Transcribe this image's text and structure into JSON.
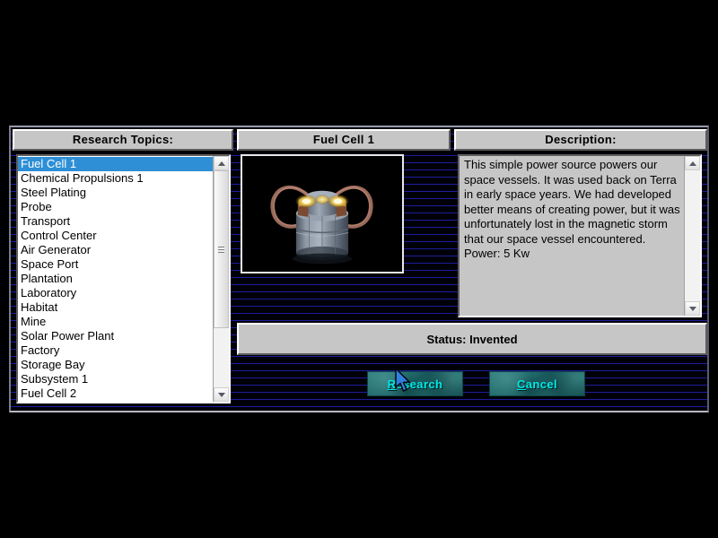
{
  "dialog": {
    "panels": {
      "research_topics_header": "Research Topics:",
      "selected_topic_header": "Fuel Cell 1",
      "description_header": "Description:"
    },
    "topics": [
      {
        "label": "Fuel Cell 1",
        "selected": true
      },
      {
        "label": "Chemical Propulsions 1",
        "selected": false
      },
      {
        "label": "Steel Plating",
        "selected": false
      },
      {
        "label": "Probe",
        "selected": false
      },
      {
        "label": "Transport",
        "selected": false
      },
      {
        "label": "Control Center",
        "selected": false
      },
      {
        "label": "Air Generator",
        "selected": false
      },
      {
        "label": "Space Port",
        "selected": false
      },
      {
        "label": "Plantation",
        "selected": false
      },
      {
        "label": "Laboratory",
        "selected": false
      },
      {
        "label": "Habitat",
        "selected": false
      },
      {
        "label": "Mine",
        "selected": false
      },
      {
        "label": "Solar Power Plant",
        "selected": false
      },
      {
        "label": "Factory",
        "selected": false
      },
      {
        "label": "Storage Bay",
        "selected": false
      },
      {
        "label": "Subsystem 1",
        "selected": false
      },
      {
        "label": "Fuel Cell 2",
        "selected": false
      }
    ],
    "preview": {
      "image_alt": "fuel-cell-render"
    },
    "description": {
      "text": "This simple power source powers our space vessels.  It was used back on Terra in early space years. We had developed better means of creating power, but it was unfortunately lost in the magnetic storm that our space vessel encountered.  Power: 5 Kw"
    },
    "status": {
      "text": "Status: Invented"
    },
    "buttons": {
      "research": {
        "accel": "R",
        "rest": "esearch"
      },
      "cancel": {
        "accel": "C",
        "rest": "ancel"
      }
    },
    "scrollbars": {
      "up_arrow": "scroll-up-arrow",
      "down_arrow": "scroll-down-arrow"
    }
  },
  "colors": {
    "background": "#000000",
    "scanline": "#1d1d9c",
    "panel_face": "#c6c6c6",
    "selection": "#2e8fd6",
    "button_face": "#1d6a6a",
    "button_text": "#00e8e8"
  }
}
